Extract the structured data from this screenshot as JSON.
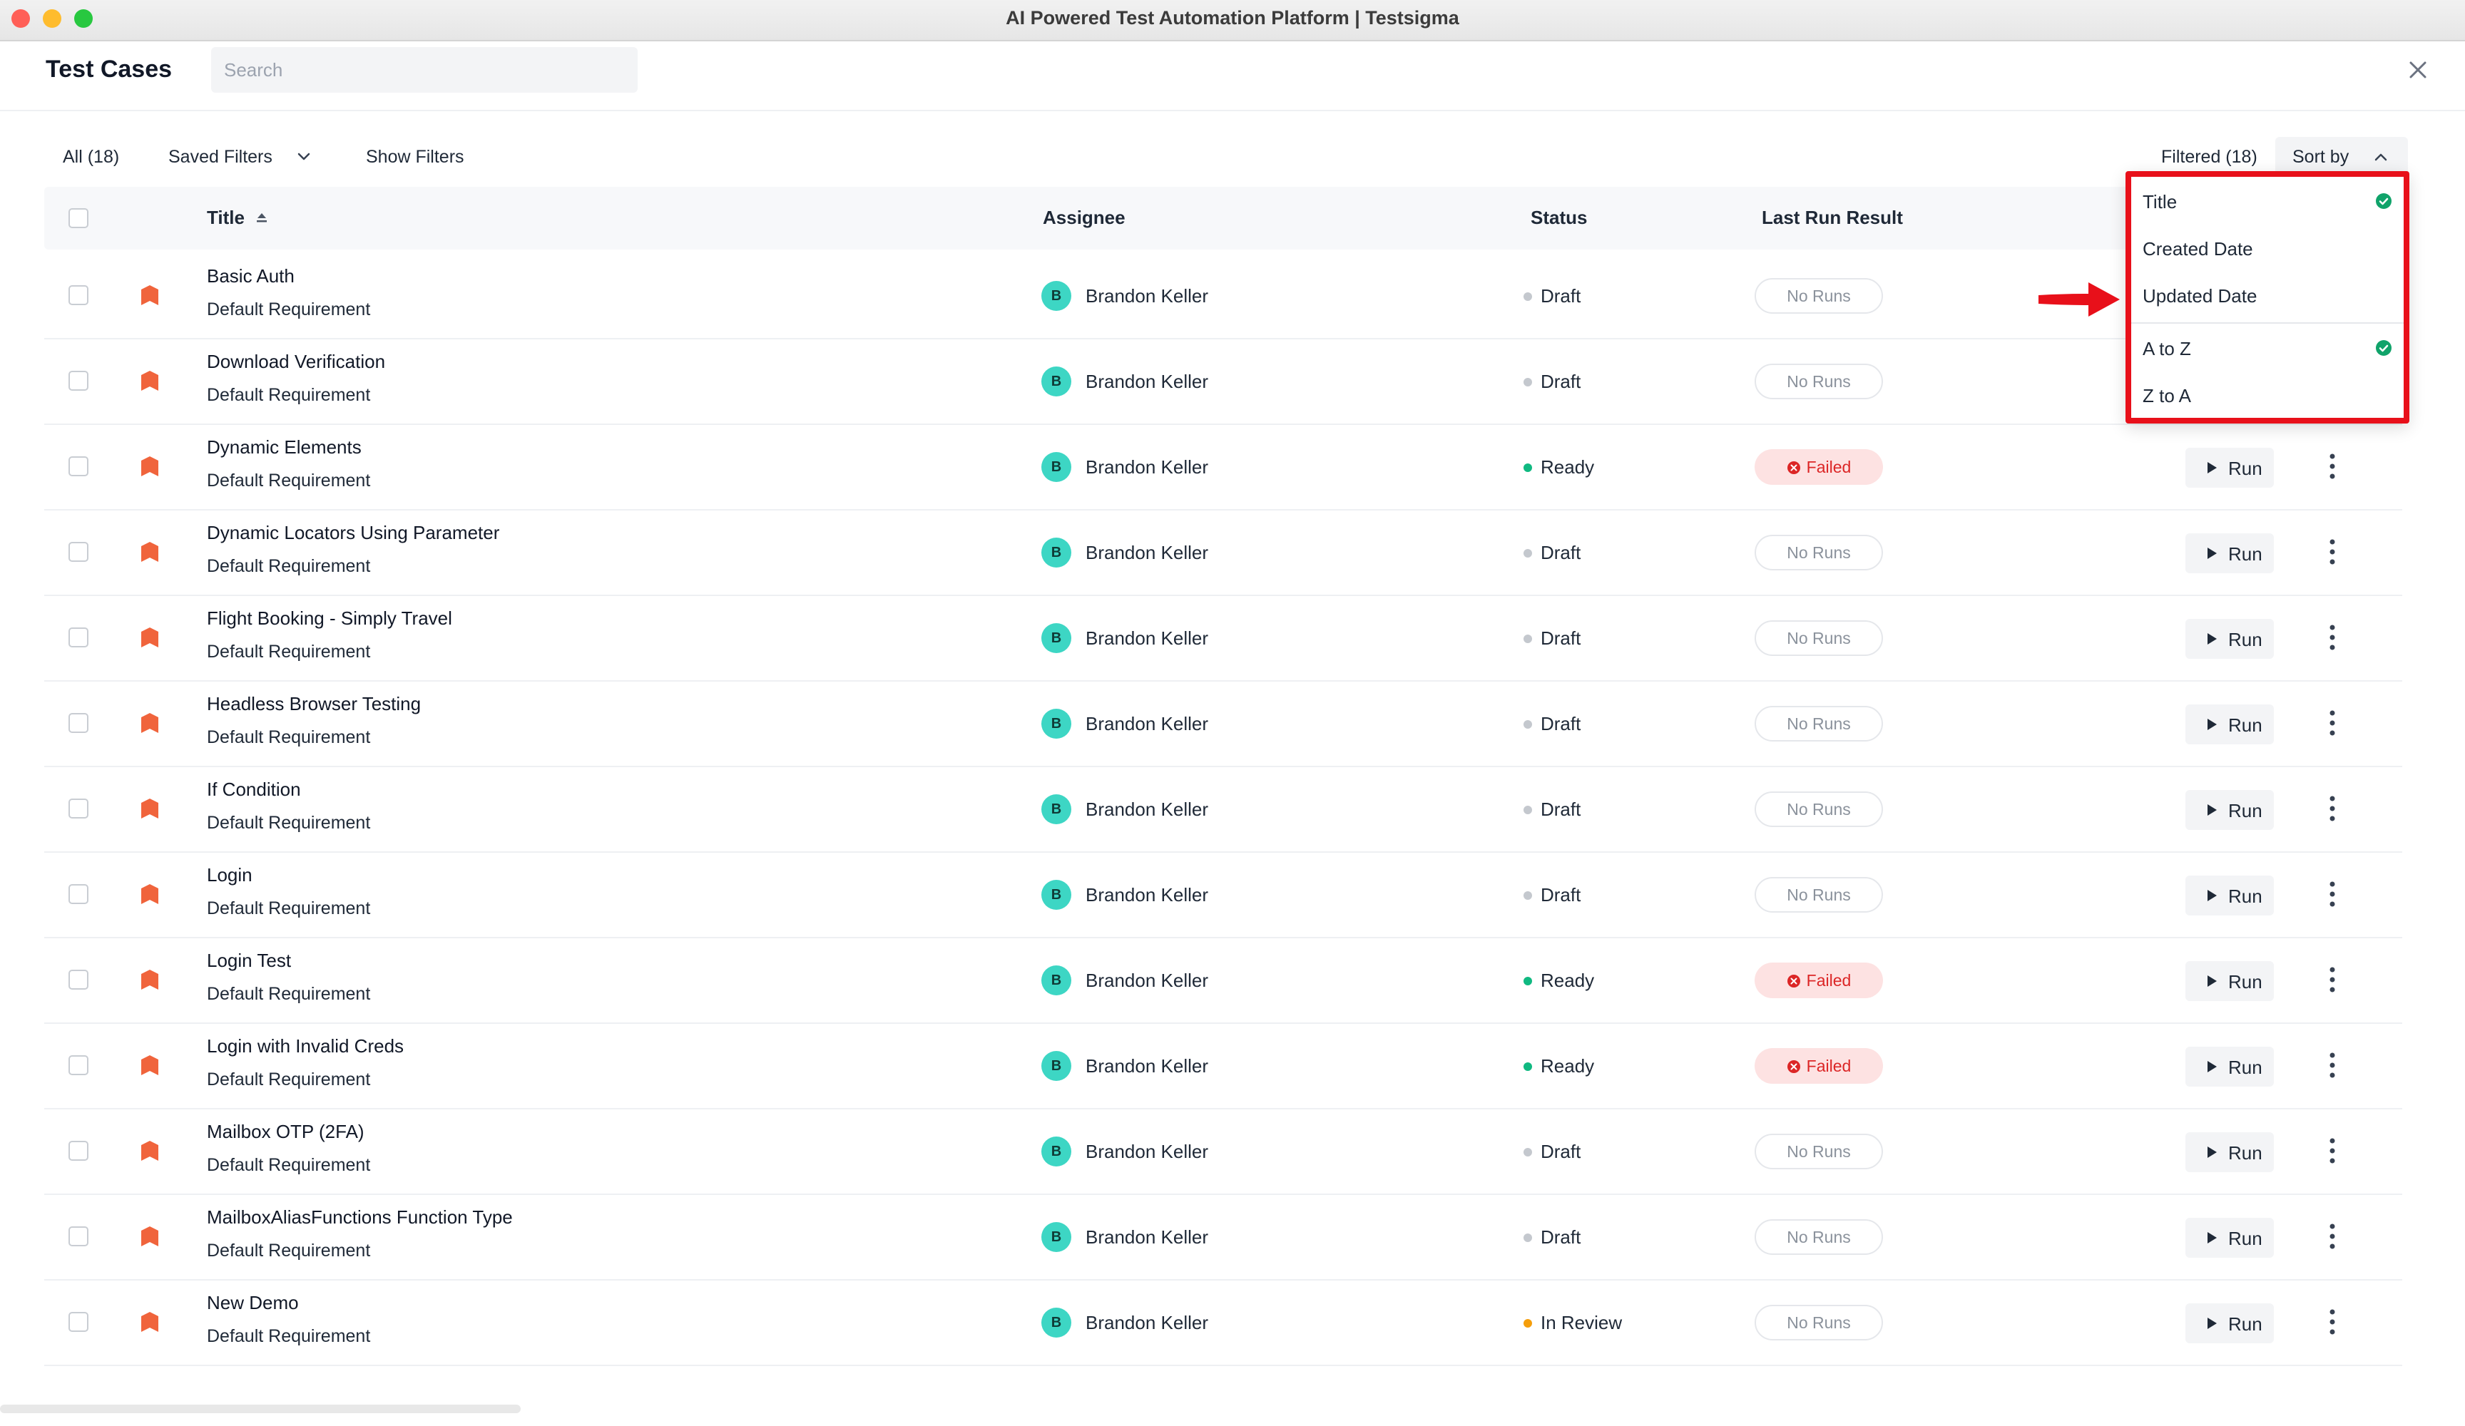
{
  "window": {
    "title": "AI Powered Test Automation Platform | Testsigma"
  },
  "header": {
    "title": "Test Cases",
    "search_placeholder": "Search"
  },
  "toolbar": {
    "all_label": "All (18)",
    "saved_filters_label": "Saved Filters",
    "show_filters_label": "Show Filters",
    "filtered_label": "Filtered (18)",
    "sort_by_label": "Sort by"
  },
  "table": {
    "columns": {
      "title": "Title",
      "assignee": "Assignee",
      "status": "Status",
      "last_run": "Last Run Result"
    },
    "run_label": "Run",
    "rows": [
      {
        "title": "Basic Auth",
        "requirement": "Default Requirement",
        "assignee_initial": "B",
        "assignee": "Brandon Keller",
        "status": "Draft",
        "status_color": "#c4c8ce",
        "result": "No Runs",
        "result_type": "none",
        "show_run": false
      },
      {
        "title": "Download Verification",
        "requirement": "Default Requirement",
        "assignee_initial": "B",
        "assignee": "Brandon Keller",
        "status": "Draft",
        "status_color": "#c4c8ce",
        "result": "No Runs",
        "result_type": "none",
        "show_run": false
      },
      {
        "title": "Dynamic Elements",
        "requirement": "Default Requirement",
        "assignee_initial": "B",
        "assignee": "Brandon Keller",
        "status": "Ready",
        "status_color": "#10b981",
        "result": "Failed",
        "result_type": "failed",
        "show_run": true
      },
      {
        "title": "Dynamic Locators Using Parameter",
        "requirement": "Default Requirement",
        "assignee_initial": "B",
        "assignee": "Brandon Keller",
        "status": "Draft",
        "status_color": "#c4c8ce",
        "result": "No Runs",
        "result_type": "none",
        "show_run": true
      },
      {
        "title": "Flight Booking - Simply Travel",
        "requirement": "Default Requirement",
        "assignee_initial": "B",
        "assignee": "Brandon Keller",
        "status": "Draft",
        "status_color": "#c4c8ce",
        "result": "No Runs",
        "result_type": "none",
        "show_run": true
      },
      {
        "title": "Headless Browser Testing",
        "requirement": "Default Requirement",
        "assignee_initial": "B",
        "assignee": "Brandon Keller",
        "status": "Draft",
        "status_color": "#c4c8ce",
        "result": "No Runs",
        "result_type": "none",
        "show_run": true
      },
      {
        "title": "If Condition",
        "requirement": "Default Requirement",
        "assignee_initial": "B",
        "assignee": "Brandon Keller",
        "status": "Draft",
        "status_color": "#c4c8ce",
        "result": "No Runs",
        "result_type": "none",
        "show_run": true
      },
      {
        "title": "Login",
        "requirement": "Default Requirement",
        "assignee_initial": "B",
        "assignee": "Brandon Keller",
        "status": "Draft",
        "status_color": "#c4c8ce",
        "result": "No Runs",
        "result_type": "none",
        "show_run": true
      },
      {
        "title": "Login Test",
        "requirement": "Default Requirement",
        "assignee_initial": "B",
        "assignee": "Brandon Keller",
        "status": "Ready",
        "status_color": "#10b981",
        "result": "Failed",
        "result_type": "failed",
        "show_run": true
      },
      {
        "title": "Login with Invalid Creds",
        "requirement": "Default Requirement",
        "assignee_initial": "B",
        "assignee": "Brandon Keller",
        "status": "Ready",
        "status_color": "#10b981",
        "result": "Failed",
        "result_type": "failed",
        "show_run": true
      },
      {
        "title": "Mailbox OTP (2FA)",
        "requirement": "Default Requirement",
        "assignee_initial": "B",
        "assignee": "Brandon Keller",
        "status": "Draft",
        "status_color": "#c4c8ce",
        "result": "No Runs",
        "result_type": "none",
        "show_run": true
      },
      {
        "title": "MailboxAliasFunctions Function Type",
        "requirement": "Default Requirement",
        "assignee_initial": "B",
        "assignee": "Brandon Keller",
        "status": "Draft",
        "status_color": "#c4c8ce",
        "result": "No Runs",
        "result_type": "none",
        "show_run": true
      },
      {
        "title": "New Demo",
        "requirement": "Default Requirement",
        "assignee_initial": "B",
        "assignee": "Brandon Keller",
        "status": "In Review",
        "status_color": "#f59e0b",
        "result": "No Runs",
        "result_type": "none",
        "show_run": true
      }
    ]
  },
  "sort_menu": {
    "field_options": [
      {
        "label": "Title",
        "selected": true
      },
      {
        "label": "Created Date",
        "selected": false
      },
      {
        "label": "Updated Date",
        "selected": false
      }
    ],
    "order_options": [
      {
        "label": "A to Z",
        "selected": true
      },
      {
        "label": "Z to A",
        "selected": false
      }
    ]
  },
  "colors": {
    "accent_check": "#10a36a",
    "priority": "#f0643c",
    "highlight": "#e8101a",
    "failed_bg": "#fde2e2",
    "failed_text": "#dc2626"
  }
}
